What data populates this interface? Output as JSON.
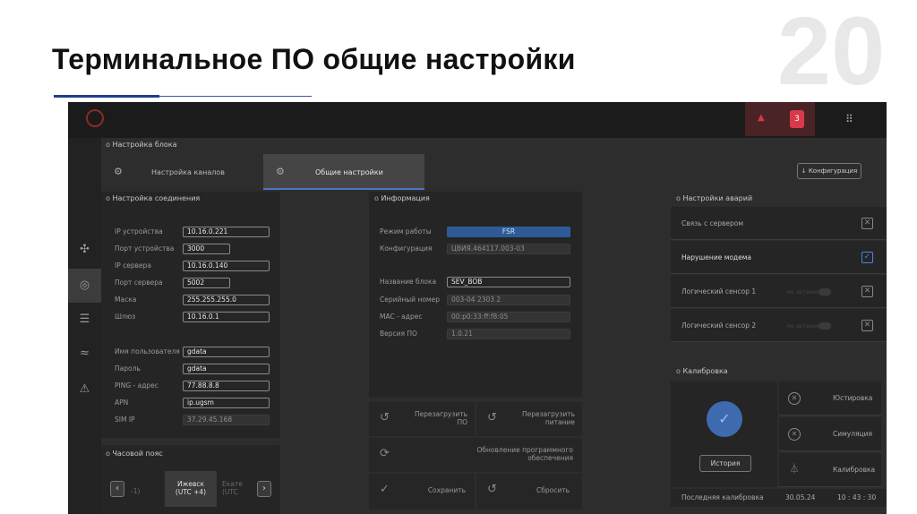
{
  "slide": {
    "title": "Терминальное ПО общие настройки",
    "number": "20"
  },
  "app": {
    "alarm_count": "3",
    "colors": {
      "alarm_red": "#d93a4a",
      "accent_blue": "#2e5b97",
      "check_blue": "#4a86e0"
    },
    "block_section": "Настройка блока",
    "tabs": [
      {
        "label": "Настройка каналов",
        "icon": "channels-icon"
      },
      {
        "label": "Общие настройки",
        "icon": "settings-icon"
      }
    ],
    "config_button": "Конфигурация",
    "connection": {
      "section": "Настройка соединения",
      "fields": [
        {
          "label": "IP устройства",
          "value": "10.16.0.221"
        },
        {
          "label": "Порт устройства",
          "value": "3000"
        },
        {
          "label": "IP сервера",
          "value": "10.16.0.140"
        },
        {
          "label": "Порт сервера",
          "value": "5002"
        },
        {
          "label": "Маска",
          "value": "255.255.255.0"
        },
        {
          "label": "Шлюз",
          "value": "10.16.0.1"
        }
      ],
      "fields2": [
        {
          "label": "Имя пользователя",
          "value": "gdata"
        },
        {
          "label": "Пароль",
          "value": "gdata"
        },
        {
          "label": "PING - адрес",
          "value": "77.88.8.8"
        },
        {
          "label": "APN",
          "value": "ip.ugsm"
        },
        {
          "label": "SIM IP",
          "value": "37.29.45.168"
        }
      ]
    },
    "timezone": {
      "section": "Часовой пояс",
      "prev": "-1)",
      "current_line1": "Ижевск",
      "current_line2": "(UTC +4)",
      "next_line1": "Екате",
      "next_line2": "(UTC"
    },
    "info": {
      "section": "Информация",
      "mode_label": "Режим работы",
      "mode_value": "FSR",
      "config_label": "Конфигурация",
      "config_value": "ЦВИЯ.464117.003-03",
      "name_label": "Название блока",
      "name_value": "SEV_BOB",
      "serial_label": "Серийный номер",
      "serial_value": "003-04 2303 2",
      "mac_label": "MAC - адрес",
      "mac_value": "00:p0:33:ff:f8:05",
      "version_label": "Версия ПО",
      "version_value": "1.0.21"
    },
    "actions": {
      "reboot_sw_1": "Перезагрузить",
      "reboot_sw_2": "ПО",
      "reboot_pw_1": "Перезагрузить",
      "reboot_pw_2": "питание",
      "update_1": "Обновление программного",
      "update_2": "обеспечения",
      "save": "Сохранить",
      "reset": "Сбросить"
    },
    "alarms": {
      "section": "Настройки аварий",
      "items": [
        {
          "label": "Связь с сервером",
          "checked": false
        },
        {
          "label": "Нарушение модема",
          "checked": true
        },
        {
          "label": "Логический сенсор 1",
          "checked": false,
          "toggle": "Не активен"
        },
        {
          "label": "Логический сенсор 2",
          "checked": false,
          "toggle": "Не активен"
        }
      ]
    },
    "calibration": {
      "section": "Калибровка",
      "history_button": "История",
      "items": [
        {
          "label": "Юстировка",
          "icon": "close-circle-icon"
        },
        {
          "label": "Симуляция",
          "icon": "close-circle-icon"
        },
        {
          "label": "Калибровка",
          "icon": "calibrate-icon"
        }
      ],
      "last_label": "Последняя калибровка",
      "last_date": "30.05.24",
      "last_time": "10 : 43 : 30"
    }
  }
}
